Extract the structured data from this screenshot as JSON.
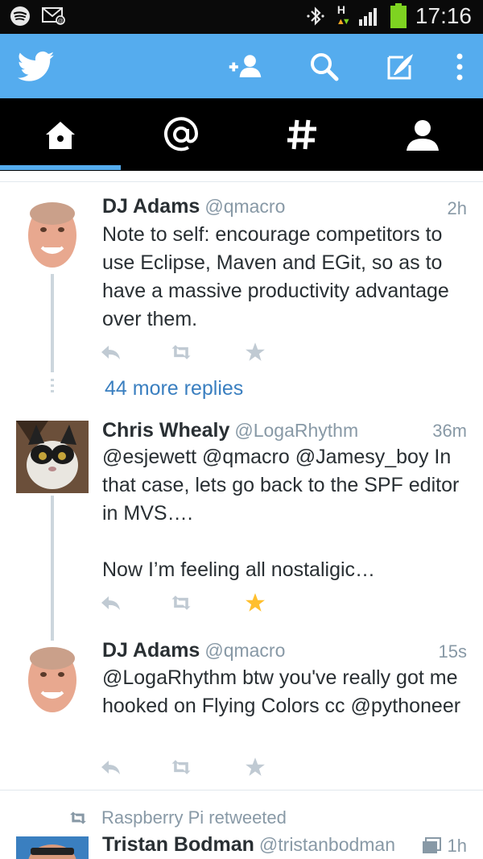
{
  "status_bar": {
    "time": "17:16",
    "network_h": "H",
    "icons": [
      "spotify-icon",
      "mail-icon",
      "bluetooth-icon",
      "network-h-icon",
      "signal-icon",
      "battery-icon"
    ]
  },
  "app_bar": {
    "icons": [
      "twitter-bird-icon",
      "add-user-icon",
      "search-icon",
      "compose-icon",
      "overflow-menu-icon"
    ],
    "accent": "#55acee"
  },
  "tabs": [
    {
      "name": "home",
      "icon": "home-icon",
      "selected": true
    },
    {
      "name": "mentions",
      "icon": "at-icon"
    },
    {
      "name": "discover",
      "icon": "hash-icon"
    },
    {
      "name": "me",
      "icon": "person-icon"
    }
  ],
  "tweets": [
    {
      "name": "DJ Adams",
      "handle": "@qmacro",
      "time": "2h",
      "text": "Note to self: encourage competitors to use Eclipse, Maven and EGit, so as to have a massive productivity advantage over them.",
      "favorited": false
    },
    {
      "name": "Chris Whealy",
      "handle": "@LogaRhythm",
      "time": "36m",
      "text": "@esjewett @qmacro @Jamesy_boy In that case, lets go back to the SPF editor in MVS….\n\nNow I’m feeling all nostaligic…",
      "favorited": true
    },
    {
      "name": "DJ Adams",
      "handle": "@qmacro",
      "time": "15s",
      "text": "@LogaRhythm btw you've really got me hooked on Flying Colors cc @pythoneer",
      "favorited": false
    }
  ],
  "more_replies": "44 more replies",
  "retweet": {
    "label": "Raspberry Pi retweeted",
    "name": "Tristan Bodman",
    "handle": "@tristanbodman",
    "time": "1h"
  },
  "colors": {
    "star_active": "#ffbf2d",
    "action_gray": "#c0cad3",
    "link_blue": "#3a7fc0"
  }
}
